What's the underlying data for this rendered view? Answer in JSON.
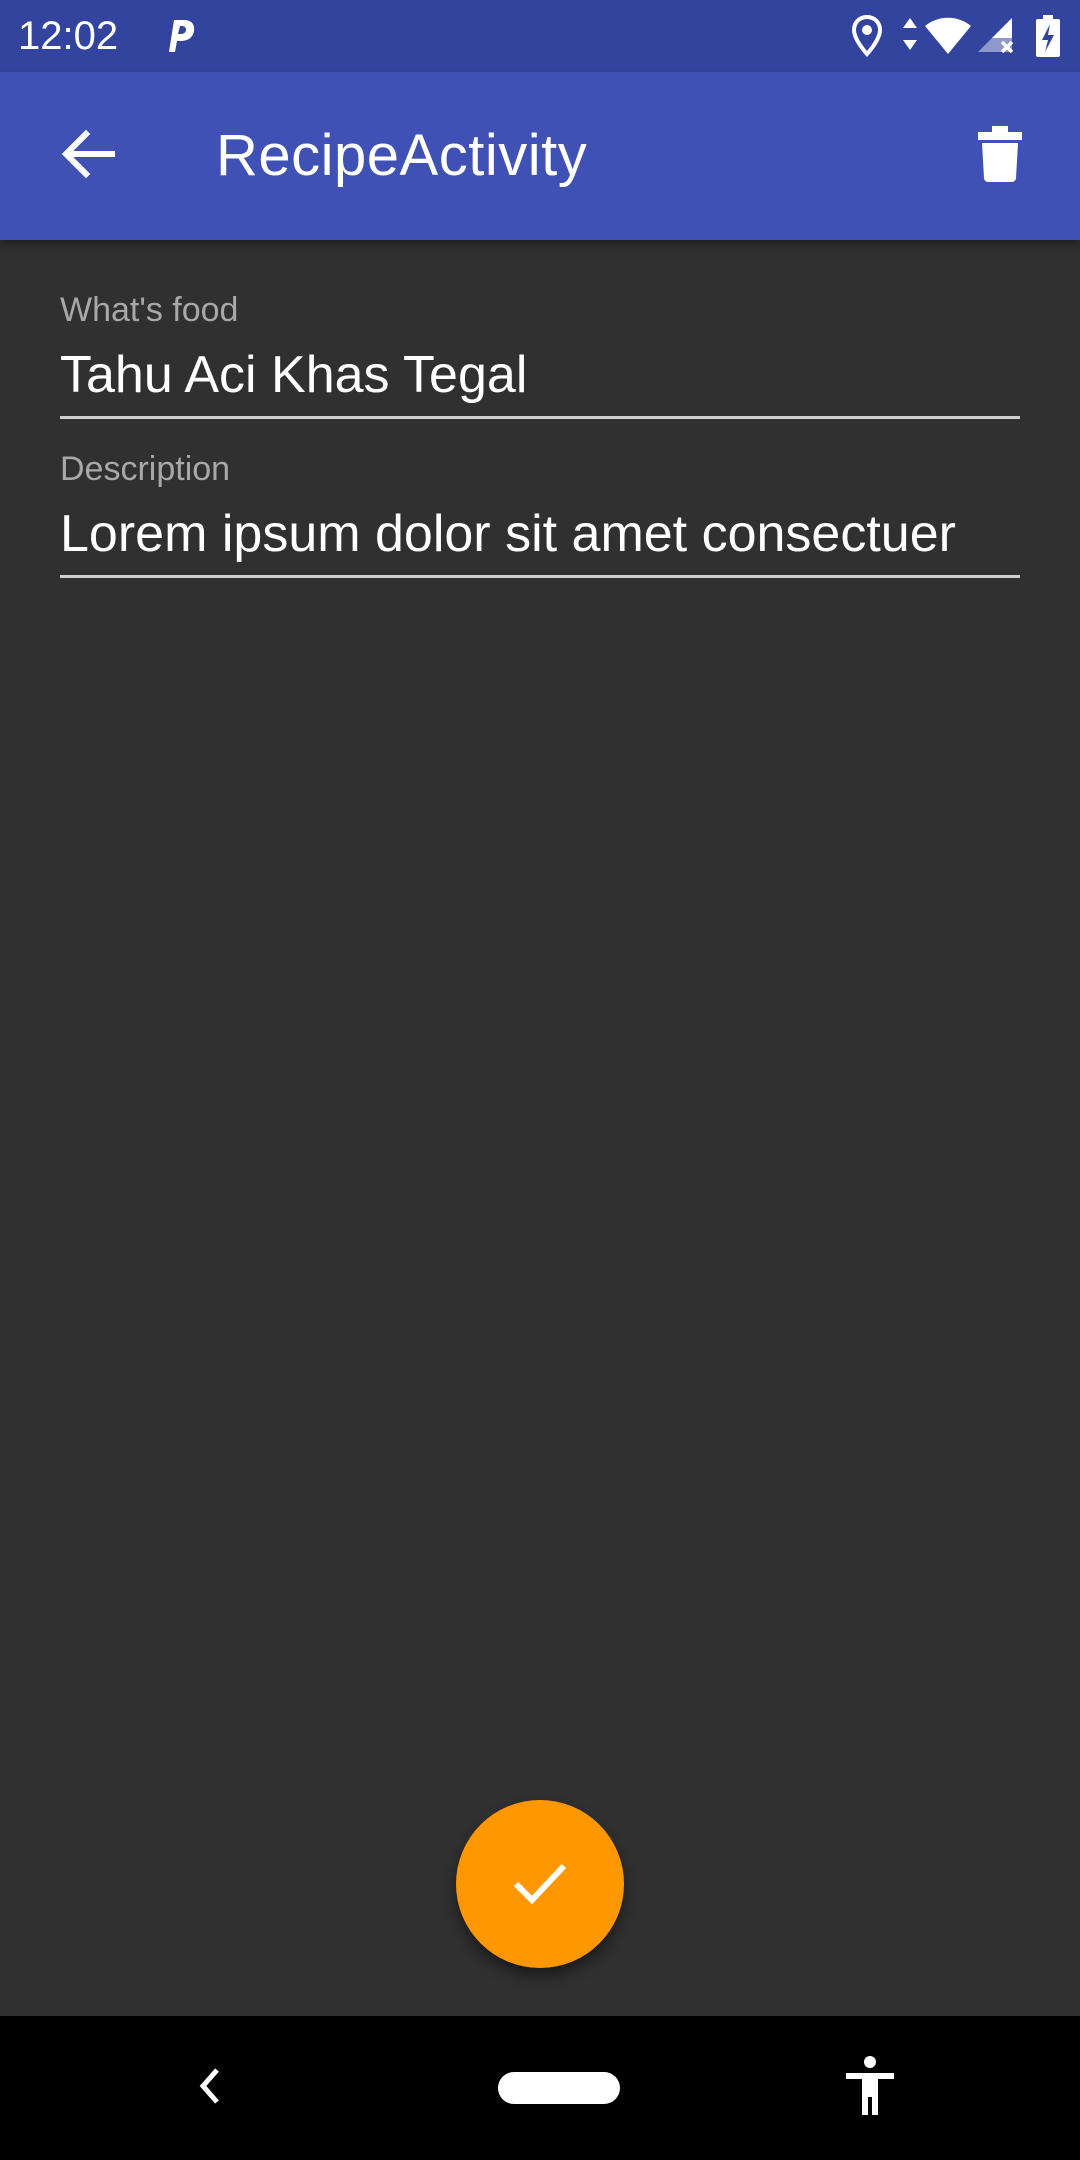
{
  "status_bar": {
    "time": "12:02",
    "background": "#33449e",
    "icons": [
      "parking-app-icon",
      "location-icon",
      "data-arrows-icon",
      "wifi-icon",
      "signal-no-service-icon",
      "battery-charging-icon"
    ]
  },
  "app_bar": {
    "title": "RecipeActivity",
    "background": "#3f51b5",
    "back_icon": "arrow-back-icon",
    "delete_icon": "trash-icon"
  },
  "form": {
    "food_field": {
      "label": "What's food",
      "value": "Tahu Aci Khas Tegal"
    },
    "description_field": {
      "label": "Description",
      "value": "Lorem ipsum dolor sit amet consectuer"
    }
  },
  "fab": {
    "icon": "check-icon",
    "color": "#ff9800"
  },
  "nav_bar": {
    "icons": [
      "nav-back-icon",
      "nav-home-pill",
      "accessibility-icon"
    ]
  },
  "theme": {
    "content_background": "#303030"
  }
}
